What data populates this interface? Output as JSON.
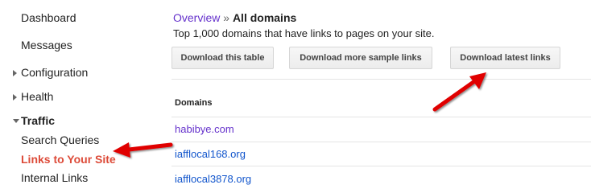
{
  "sidebar": {
    "items": [
      {
        "label": "Dashboard"
      },
      {
        "label": "Messages"
      },
      {
        "label": "Configuration"
      },
      {
        "label": "Health"
      },
      {
        "label": "Traffic"
      },
      {
        "label": "Search Queries"
      },
      {
        "label": "Links to Your Site"
      },
      {
        "label": "Internal Links"
      }
    ]
  },
  "breadcrumb": {
    "parent": "Overview",
    "separator": "»",
    "current": "All domains"
  },
  "description": "Top 1,000 domains that have links to pages on your site.",
  "buttons": {
    "download_table": "Download this table",
    "download_more_samples": "Download more sample links",
    "download_latest": "Download latest links"
  },
  "table": {
    "header": "Domains",
    "rows": [
      "habibye.com",
      "iafflocal168.org",
      "iafflocal3878.org"
    ]
  },
  "colors": {
    "active_nav": "#dd4b39",
    "visited_link": "#6633cc",
    "link": "#1155cc",
    "annotation_arrow": "#e00000"
  }
}
